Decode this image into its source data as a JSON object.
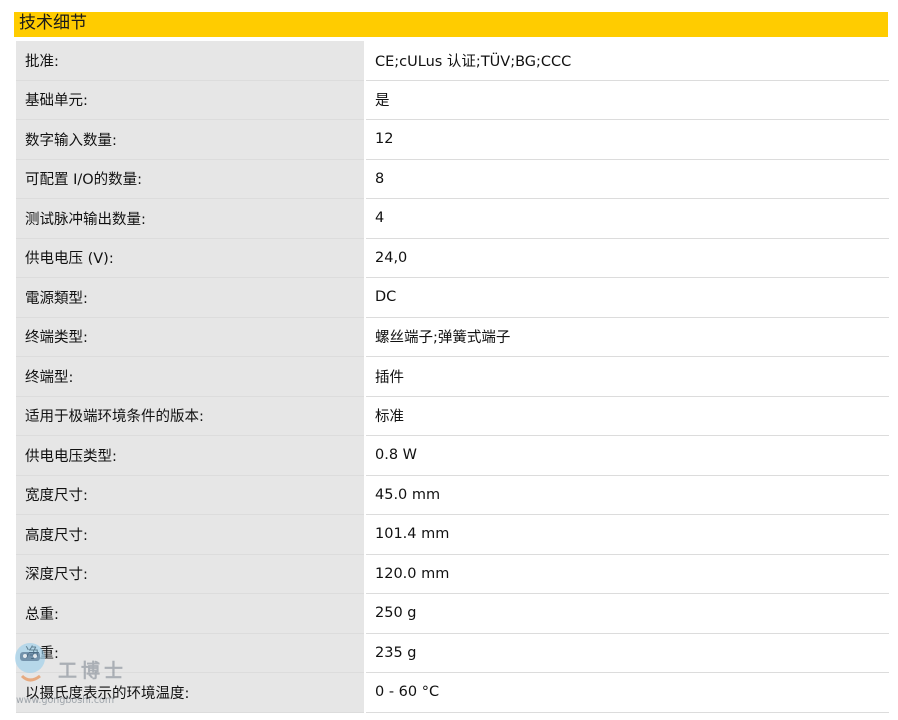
{
  "section": {
    "title": "技术细节"
  },
  "specs": [
    {
      "label": "批准:",
      "value": "CE;cULus 认证;TÜV;BG;CCC"
    },
    {
      "label": "基础单元:",
      "value": "是"
    },
    {
      "label": "数字输入数量:",
      "value": "12"
    },
    {
      "label": "可配置 I/O的数量:",
      "value": "8"
    },
    {
      "label": "测试脉冲输出数量:",
      "value": "4"
    },
    {
      "label": "供电电压 (V):",
      "value": "24,0"
    },
    {
      "label": "電源類型:",
      "value": "DC"
    },
    {
      "label": "终端类型:",
      "value": "螺丝端子;弹簧式端子"
    },
    {
      "label": "终端型:",
      "value": "插件"
    },
    {
      "label": "适用于极端环境条件的版本:",
      "value": "标准"
    },
    {
      "label": "供电电压类型:",
      "value": "0.8 W"
    },
    {
      "label": "宽度尺寸:",
      "value": "45.0 mm"
    },
    {
      "label": "高度尺寸:",
      "value": "101.4 mm"
    },
    {
      "label": "深度尺寸:",
      "value": "120.0 mm"
    },
    {
      "label": "总重:",
      "value": "250 g"
    },
    {
      "label": "净重:",
      "value": "235 g"
    },
    {
      "label": "以摄氏度表示的环境温度:",
      "value": "0 - 60 °C"
    }
  ],
  "watermark": {
    "brand": "工博士",
    "url": "www.gongboshi.com"
  }
}
